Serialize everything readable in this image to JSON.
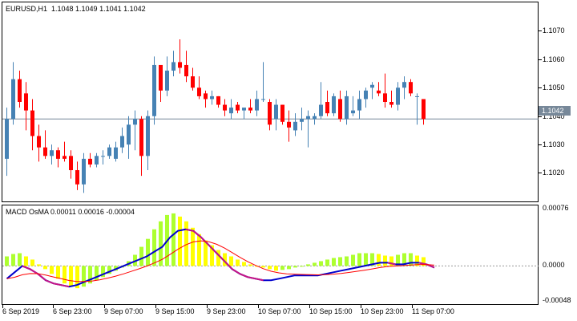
{
  "window": {
    "symbol_line": "EURUSD,H1  1.1048 1.1049 1.1041 1.1042",
    "indicator_line": "MACD OsMA 0.00011 0.00016 -0.00004",
    "current_price_tag": "1.1042"
  },
  "price_axis": {
    "labels": [
      "1.1070",
      "1.1060",
      "1.1050",
      "1.1040",
      "1.1030",
      "1.1020"
    ]
  },
  "indicator_axis": {
    "labels": [
      "0.00076",
      "0.0000",
      "-0.00048"
    ]
  },
  "time_axis": {
    "labels": [
      "6 Sep 2019",
      "6 Sep 23:00",
      "9 Sep 07:00",
      "9 Sep 15:00",
      "9 Sep 23:00",
      "10 Sep 07:00",
      "10 Sep 15:00",
      "10 Sep 23:00",
      "11 Sep 07:00"
    ]
  },
  "colors": {
    "bull": "#4682b4",
    "bear": "#ff0000",
    "hist_pos": "#ffff00",
    "hist_neg": "#adff2f",
    "macd_line": "#0000cd",
    "signal_line": "#ff0000",
    "macd_magenta": "#c71585",
    "price_line": "#778899"
  },
  "chart_data": [
    {
      "type": "candlestick",
      "title": "EURUSD,H1",
      "ylim": [
        1.1013,
        1.1083
      ],
      "last_price": 1.1042,
      "candles": [
        [
          1.1028,
          1.1046,
          1.1022,
          1.1042
        ],
        [
          1.1042,
          1.1062,
          1.104,
          1.1056
        ],
        [
          1.1056,
          1.1059,
          1.1046,
          1.1048
        ],
        [
          1.1051,
          1.1055,
          1.1038,
          1.1045
        ],
        [
          1.1045,
          1.1049,
          1.1031,
          1.1036
        ],
        [
          1.1036,
          1.104,
          1.1027,
          1.1032
        ],
        [
          1.1032,
          1.1038,
          1.1028,
          1.1029
        ],
        [
          1.1029,
          1.1033,
          1.1026,
          1.1031
        ],
        [
          1.1031,
          1.1032,
          1.1025,
          1.1028
        ],
        [
          1.1029,
          1.1034,
          1.1027,
          1.1028
        ],
        [
          1.1029,
          1.1031,
          1.1021,
          1.1024
        ],
        [
          1.1024,
          1.1027,
          1.1017,
          1.1019
        ],
        [
          1.1019,
          1.103,
          1.1016,
          1.1028
        ],
        [
          1.1028,
          1.103,
          1.1025,
          1.1026
        ],
        [
          1.1026,
          1.103,
          1.1025,
          1.1029
        ],
        [
          1.1029,
          1.1031,
          1.1026,
          1.1029
        ],
        [
          1.1029,
          1.1033,
          1.1028,
          1.1032
        ],
        [
          1.1028,
          1.1034,
          1.1027,
          1.1032
        ],
        [
          1.1032,
          1.1039,
          1.103,
          1.1036
        ],
        [
          1.1033,
          1.1043,
          1.1028,
          1.104
        ],
        [
          1.104,
          1.1045,
          1.1031,
          1.1042
        ],
        [
          1.1042,
          1.1043,
          1.1022,
          1.1029
        ],
        [
          1.1029,
          1.1045,
          1.1024,
          1.1043
        ],
        [
          1.1043,
          1.1064,
          1.104,
          1.1061
        ],
        [
          1.1061,
          1.1061,
          1.1048,
          1.1052
        ],
        [
          1.1052,
          1.1064,
          1.105,
          1.1059
        ],
        [
          1.1059,
          1.1066,
          1.1057,
          1.1062
        ],
        [
          1.1062,
          1.107,
          1.1058,
          1.106
        ],
        [
          1.1061,
          1.1066,
          1.1055,
          1.1057
        ],
        [
          1.1057,
          1.106,
          1.1052,
          1.1053
        ],
        [
          1.1053,
          1.1057,
          1.1049,
          1.105
        ],
        [
          1.1051,
          1.1052,
          1.1046,
          1.1049
        ],
        [
          1.1049,
          1.1052,
          1.1047,
          1.105
        ],
        [
          1.105,
          1.105,
          1.1046,
          1.1047
        ],
        [
          1.1047,
          1.1049,
          1.1043,
          1.1045
        ],
        [
          1.1044,
          1.1049,
          1.1042,
          1.1046
        ],
        [
          1.1047,
          1.1048,
          1.1044,
          1.1045
        ],
        [
          1.1045,
          1.1046,
          1.1042,
          1.1046
        ],
        [
          1.1046,
          1.1049,
          1.1044,
          1.1045
        ],
        [
          1.1045,
          1.1052,
          1.1043,
          1.1049
        ],
        [
          1.1049,
          1.1062,
          1.1048,
          1.1049
        ],
        [
          1.1048,
          1.1049,
          1.1038,
          1.104
        ],
        [
          1.1042,
          1.1049,
          1.1038,
          1.1047
        ],
        [
          1.1047,
          1.1047,
          1.104,
          1.1041
        ],
        [
          1.1041,
          1.1045,
          1.1034,
          1.1039
        ],
        [
          1.1038,
          1.1044,
          1.1036,
          1.1041
        ],
        [
          1.1041,
          1.1046,
          1.1038,
          1.1042
        ],
        [
          1.1042,
          1.1045,
          1.1032,
          1.1043
        ],
        [
          1.1042,
          1.1044,
          1.104,
          1.1043
        ],
        [
          1.1043,
          1.1055,
          1.1042,
          1.1047
        ],
        [
          1.1048,
          1.1052,
          1.1043,
          1.1044
        ],
        [
          1.1044,
          1.1051,
          1.1043,
          1.105
        ],
        [
          1.1049,
          1.1052,
          1.1041,
          1.1042
        ],
        [
          1.1042,
          1.1052,
          1.104,
          1.105
        ],
        [
          1.1044,
          1.105,
          1.1043,
          1.1045
        ],
        [
          1.1045,
          1.1052,
          1.1042,
          1.1049
        ],
        [
          1.1049,
          1.1053,
          1.1046,
          1.1052
        ],
        [
          1.1053,
          1.1055,
          1.1049,
          1.1054
        ],
        [
          1.1052,
          1.1055,
          1.105,
          1.1051
        ],
        [
          1.1051,
          1.1058,
          1.1046,
          1.1048
        ],
        [
          1.1048,
          1.1052,
          1.1046,
          1.1047
        ],
        [
          1.1047,
          1.1055,
          1.1045,
          1.1053
        ],
        [
          1.1053,
          1.1057,
          1.1049,
          1.1055
        ],
        [
          1.1055,
          1.1056,
          1.105,
          1.1051
        ],
        [
          1.105,
          1.1051,
          1.104,
          1.105
        ],
        [
          1.1049,
          1.1049,
          1.104,
          1.1042
        ]
      ]
    },
    {
      "type": "bar+line",
      "title": "MACD OsMA",
      "ylim": [
        -0.00048,
        0.00076
      ],
      "histogram": [
        0.00012,
        0.00015,
        0.00016,
        0.00012,
        8e-05,
        2e-05,
        -4e-05,
        -0.0001,
        -0.00016,
        -0.00022,
        -0.00026,
        -0.00028,
        -0.00026,
        -0.00022,
        -0.00018,
        -0.00014,
        -0.0001,
        -6e-05,
        -2e-05,
        6e-05,
        0.00014,
        0.00024,
        0.00034,
        0.00046,
        0.00056,
        0.00064,
        0.00066,
        0.00062,
        0.00056,
        0.00048,
        0.0004,
        0.00032,
        0.00026,
        0.0002,
        0.00016,
        0.00012,
        8e-05,
        5e-05,
        2e-05,
        0.0,
        -2e-05,
        -4e-05,
        -6e-05,
        -5e-05,
        -4e-05,
        -2e-05,
        0.0,
        2e-05,
        4e-05,
        6e-05,
        8e-05,
        0.0001,
        0.00011,
        0.00012,
        0.00014,
        0.00016,
        0.00016,
        0.00016,
        0.00015,
        0.00013,
        0.00012,
        0.00014,
        0.00016,
        0.00016,
        0.00013,
        0.00011
      ],
      "macd": [
        -0.00016,
        -8e-05,
        0.0,
        -4e-05,
        -0.0001,
        -0.00018,
        -0.00022,
        -0.00024,
        -0.00026,
        -0.00024,
        -0.0002,
        -0.00016,
        -0.00012,
        -8e-05,
        -4e-05,
        0.0,
        4e-05,
        8e-05,
        0.00012,
        0.00018,
        0.00024,
        0.00036,
        0.00044,
        0.00046,
        0.00044,
        0.00036,
        0.00026,
        0.00016,
        6e-05,
        -4e-05,
        -0.0001,
        -0.00014,
        -0.00016,
        -0.00018,
        -0.00018,
        -0.00016,
        -0.00014,
        -0.00012,
        -0.00012,
        -0.00012,
        -0.00012,
        -0.0001,
        -8e-05,
        -6e-05,
        -4e-05,
        -2e-05,
        0.0,
        2e-05,
        4e-05,
        4e-05,
        2e-05,
        2e-05,
        4e-05,
        4e-05,
        2e-05,
        -2e-05
      ]
    }
  ]
}
